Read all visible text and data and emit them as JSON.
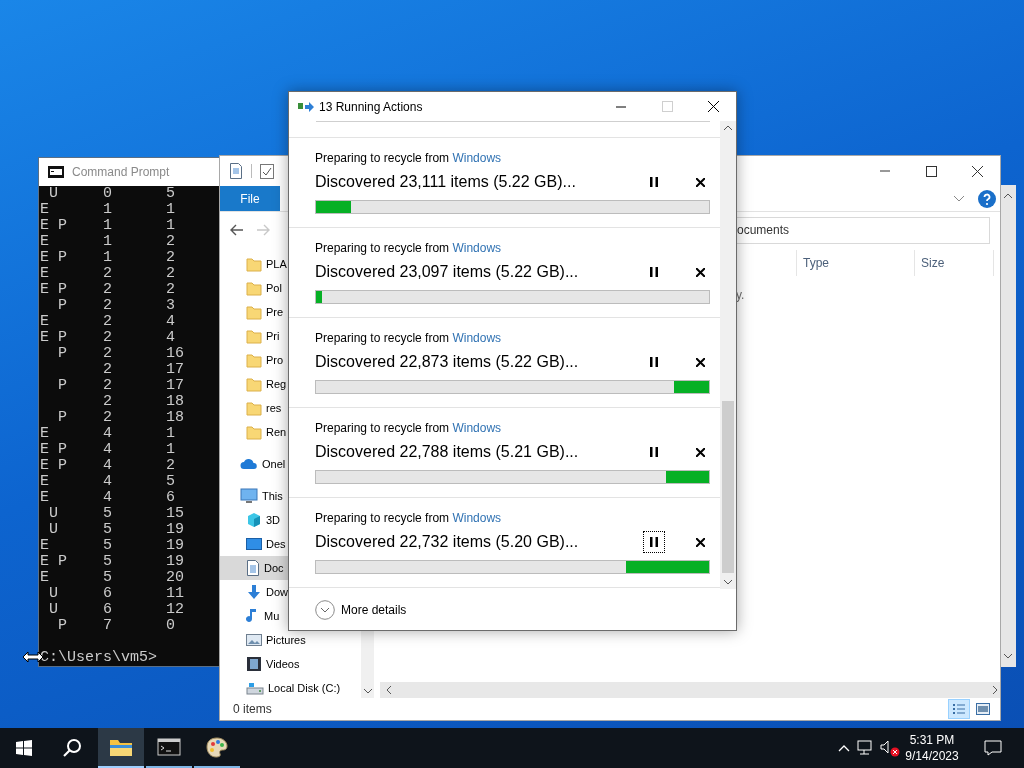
{
  "command_prompt": {
    "title": "Command Prompt",
    "lines": [
      " U     0      5",
      "E      1      1",
      "E P    1      1",
      "E      1      2",
      "E P    1      2",
      "E      2      2",
      "E P    2      2",
      "  P    2      3",
      "E      2      4",
      "E P    2      4",
      "  P    2      16",
      "       2      17",
      "  P    2      17",
      "       2      18",
      "  P    2      18",
      "E      4      1",
      "E P    4      1",
      "E P    4      2",
      "E      4      5",
      "E      4      6",
      " U     5      15",
      " U     5      19",
      "E      5      19",
      "E P    5      19",
      "E      5      20",
      " U     6      11",
      " U     6      12",
      "  P    7      0"
    ],
    "prompt": "C:\\Users\\vm5>"
  },
  "explorer": {
    "ribbon_tab": "File",
    "address": "ocuments",
    "columns": [
      "Type",
      "Size"
    ],
    "empty_text": "y.",
    "pinned_folders": [
      {
        "label": "PLA"
      },
      {
        "label": "Pol"
      },
      {
        "label": "Pre"
      },
      {
        "label": "Pri"
      },
      {
        "label": "Pro"
      },
      {
        "label": "Reg"
      },
      {
        "label": "res"
      },
      {
        "label": "Ren"
      }
    ],
    "nav_items": [
      {
        "label": "Onel",
        "kind": "cloud",
        "selected": false
      },
      {
        "label": "This",
        "kind": "pc",
        "selected": false,
        "children": [
          {
            "label": "3D",
            "kind": "cube",
            "selected": false
          },
          {
            "label": "Des",
            "kind": "desktop",
            "selected": false
          },
          {
            "label": "Doc",
            "kind": "documents",
            "selected": true
          },
          {
            "label": "Dow",
            "kind": "downloads",
            "selected": false
          },
          {
            "label": "Mu",
            "kind": "music",
            "selected": false
          },
          {
            "label": "Pictures",
            "kind": "pictures",
            "selected": false
          },
          {
            "label": "Videos",
            "kind": "videos",
            "selected": false
          },
          {
            "label": "Local Disk (C:)",
            "kind": "disk",
            "selected": false
          }
        ]
      }
    ],
    "status": "0 items",
    "views": [
      {
        "kind": "details",
        "selected": true
      },
      {
        "kind": "large",
        "selected": false
      }
    ]
  },
  "dialog": {
    "title": "13 Running Actions",
    "maximize_disabled": true,
    "actions": [
      {
        "action": "Preparing to recycle from",
        "source": "Windows",
        "status": "Discovered 23,111 items (5.22 GB)...",
        "kind": "progress",
        "level": 0.09,
        "focused": false
      },
      {
        "action": "Preparing to recycle from",
        "source": "Windows",
        "status": "Discovered 23,097 items (5.22 GB)...",
        "kind": "progress",
        "level": 0.015,
        "focused": false
      },
      {
        "action": "Preparing to recycle from",
        "source": "Windows",
        "status": "Discovered 22,873 items (5.22 GB)...",
        "kind": "marquee",
        "level": 0.09,
        "focused": false
      },
      {
        "action": "Preparing to recycle from",
        "source": "Windows",
        "status": "Discovered 22,788 items (5.21 GB)...",
        "kind": "marquee",
        "level": 0.11,
        "focused": false
      },
      {
        "action": "Preparing to recycle from",
        "source": "Windows",
        "status": "Discovered 22,732 items (5.20 GB)...",
        "kind": "marquee",
        "level": 0.21,
        "focused": true
      }
    ],
    "more_details": "More details"
  },
  "taskbar": {
    "apps": [
      {
        "kind": "explorer",
        "selected": true
      },
      {
        "kind": "terminal",
        "selected": false
      },
      {
        "kind": "paint",
        "selected": false
      }
    ],
    "time": "5:31 PM",
    "date": "9/14/2023"
  }
}
